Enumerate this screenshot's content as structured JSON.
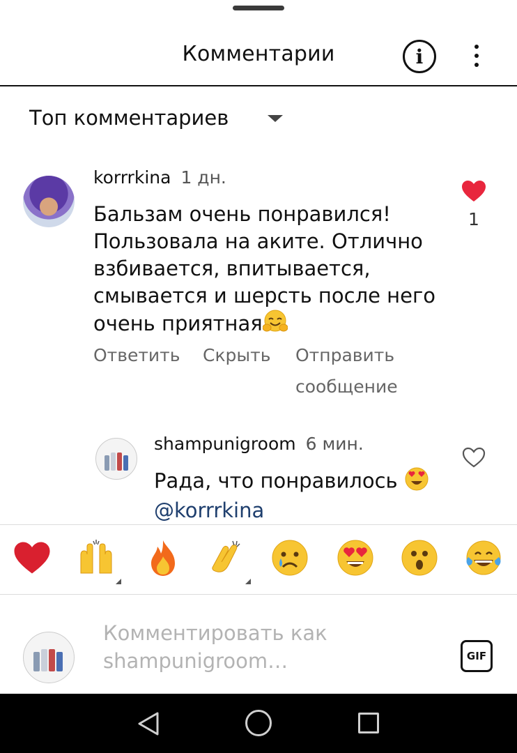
{
  "header": {
    "title": "Комментарии"
  },
  "sort": {
    "label": "Топ комментариев"
  },
  "comment": {
    "username": "korrrkina",
    "time": "1 дн.",
    "text": "Бальзам очень понравился! Пользовала на аките. Отлично взбивается, впитывается, смывается и шерсть после него очень приятная",
    "text_emoji": "hugging-face",
    "likes": "1",
    "actions": {
      "reply": "Ответить",
      "hide": "Скрыть",
      "send_line1": "Отправить",
      "send_line2": "сообщение"
    }
  },
  "reply": {
    "username": "shampunigroom",
    "time": "6 мин.",
    "text": "Рада, что понравилось",
    "text_emoji": "heart-eyes",
    "mention": "@korrrkina"
  },
  "emoji_bar": [
    "red-heart",
    "raised-hands",
    "fire",
    "clapping-hands",
    "crying-face",
    "heart-eyes-face",
    "surprised-face",
    "tears-of-joy-face"
  ],
  "input": {
    "placeholder": "Комментировать как shampunigroom…",
    "gif_label": "GIF"
  },
  "colors": {
    "like_red": "#e8263d",
    "mention_blue": "#1f3f6e",
    "placeholder_gray": "#b3b3b3"
  }
}
